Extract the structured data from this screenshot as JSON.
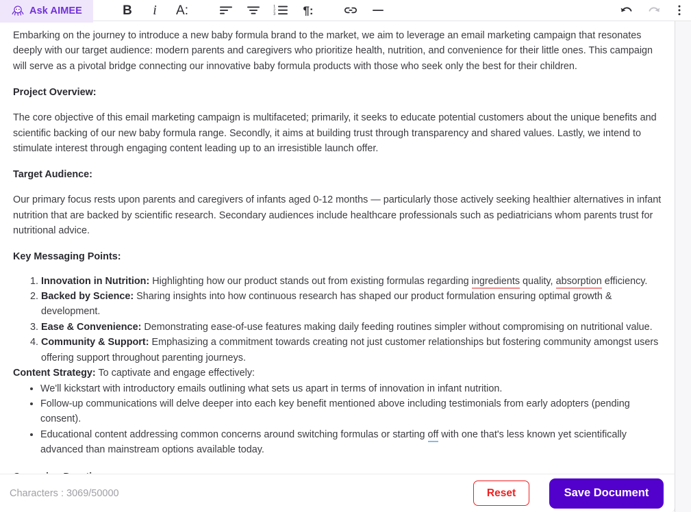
{
  "toolbar": {
    "aimee_tab": {
      "label": "Ask AIMEE",
      "icon": "octopus-ai-icon",
      "bg_color": "#efe6fc",
      "text_color": "#7030d8"
    },
    "buttons": [
      {
        "name": "bold",
        "glyph": "B",
        "label": "Bold"
      },
      {
        "name": "italic",
        "glyph": "i",
        "label": "Italic"
      },
      {
        "name": "text-style",
        "glyph": "A:",
        "label": "Text style"
      },
      {
        "name": "align-left",
        "glyph": "",
        "label": "Align left"
      },
      {
        "name": "align-center",
        "glyph": "",
        "label": "Align center"
      },
      {
        "name": "numbered-list",
        "glyph": "",
        "label": "Numbered list"
      },
      {
        "name": "paragraph-format",
        "glyph": "¶:",
        "label": "Paragraph format"
      },
      {
        "name": "insert-link",
        "glyph": "",
        "label": "Insert link"
      },
      {
        "name": "horizontal-rule",
        "glyph": "—",
        "label": "Horizontal rule"
      },
      {
        "name": "undo",
        "glyph": "",
        "label": "Undo",
        "state": "enabled"
      },
      {
        "name": "redo",
        "glyph": "",
        "label": "Redo",
        "state": "disabled"
      },
      {
        "name": "more-options",
        "glyph": "⋮",
        "label": "More options"
      }
    ]
  },
  "document": {
    "intro": "Embarking on the journey to introduce a new baby formula brand to the market, we aim to leverage an email marketing campaign that resonates deeply with our target audience: modern parents and caregivers who prioritize health, nutrition, and convenience for their little ones. This campaign will serve as a pivotal bridge connecting our innovative baby formula products with those who seek only the best for their children.",
    "project_overview_heading": "Project Overview:",
    "project_overview_body": "The core objective of this email marketing campaign is multifaceted; primarily, it seeks to educate potential customers about the unique benefits and scientific backing of our new baby formula range. Secondly, it aims at building trust through transparency and shared values. Lastly, we intend to stimulate interest through engaging content leading up to an irresistible launch offer.",
    "target_audience_heading": "Target Audience:",
    "target_audience_body": "Our primary focus rests upon parents and caregivers of infants aged 0-12 months — particularly those actively seeking healthier alternatives in infant nutrition that are backed by scientific research. Secondary audiences include healthcare professionals such as pediatricians whom parents trust for nutritional advice.",
    "key_messaging_heading": "Key Messaging Points:",
    "key_messaging_points": [
      {
        "term": "Innovation in Nutrition:",
        "text_before": " Highlighting how our product stands out from existing formulas regarding ",
        "suggestion_1": "ingredients",
        "text_middle": " quality, ",
        "suggestion_2": "absorption",
        "text_after": " efficiency."
      },
      {
        "term": "Backed by Science:",
        "text": " Sharing insights into how continuous research has shaped our product formulation ensuring optimal growth & development."
      },
      {
        "term": "Ease & Convenience:",
        "text": " Demonstrating ease-of-use features making daily feeding routines simpler without compromising on nutritional value."
      },
      {
        "term": "Community & Support:",
        "text": " Emphasizing a commitment towards creating not just customer relationships but fostering community amongst users offering support throughout parenting journeys."
      }
    ],
    "content_strategy_label": "Content Strategy:",
    "content_strategy_rest": " To captivate and engage effectively:",
    "content_strategy_bullets": [
      {
        "text": "We'll kickstart with introductory emails outlining what sets us apart in terms of innovation in infant nutrition."
      },
      {
        "text": "Follow-up communications will delve deeper into each key benefit mentioned above including testimonials from early adopters (pending consent)."
      },
      {
        "text_before": "Educational content addressing common concerns around switching formulas or starting ",
        "suggestion": "off",
        "text_after": " with one that's less known yet scientifically advanced than mainstream options available today."
      }
    ],
    "campaign_duration_heading": "Campaign Duration"
  },
  "footer": {
    "character_count": "Characters : 3069/50000",
    "reset_label": "Reset",
    "save_label": "Save Document",
    "reset_color": "#f01f1f",
    "save_color": "#5200cc"
  },
  "suggestion_colors": {
    "spelling_underline": "#f08c8c",
    "style_underline": "#8ab8ea"
  }
}
